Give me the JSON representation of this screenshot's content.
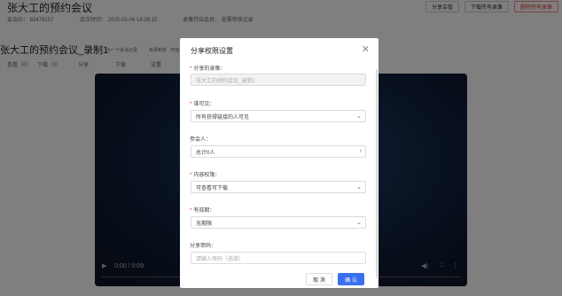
{
  "background": {
    "meeting_title": "张大工的预约会议",
    "meta": {
      "meeting_id": "会议ID：  83478257",
      "meeting_time": "会议时间：  2025-05-06 14:39:15",
      "host": "录像开启会员：  无需审核记录"
    },
    "header_buttons": [
      "分享会暂",
      "下载所有录像",
      "删除所有录像"
    ],
    "recording_title": "张大工的预约会议_录制1",
    "tags": [
      "为一个会话记录",
      "有录制条",
      "开放录制"
    ],
    "info_row": [
      "查看（0）",
      "下载（0）",
      "分享",
      "下载",
      "设置"
    ],
    "player": {
      "time": "0:00 / 0:09"
    }
  },
  "modal": {
    "title": "分享权限设置",
    "fields": {
      "share_title": {
        "label": "分享的录像：",
        "required": true,
        "value": "张大工的预约会议_录制1"
      },
      "visibility": {
        "label": "谁可见：",
        "required": true,
        "value": "所有获得链接的人可见"
      },
      "participants": {
        "label": "参会人：",
        "required": false,
        "value": "总计0人"
      },
      "permission": {
        "label": "内容权限：",
        "required": true,
        "value": "可查看可下载"
      },
      "validity": {
        "label": "有效期：",
        "required": true,
        "value": "无期限"
      },
      "password": {
        "label": "分享密码：",
        "required": false,
        "placeholder": "请输入密码（选填）"
      }
    },
    "buttons": {
      "cancel": "取 消",
      "confirm": "确 认"
    }
  },
  "colors": {
    "primary": "#3a6ff0",
    "required": "#e33333",
    "overlay": "rgba(0,0,0,0.5)"
  }
}
